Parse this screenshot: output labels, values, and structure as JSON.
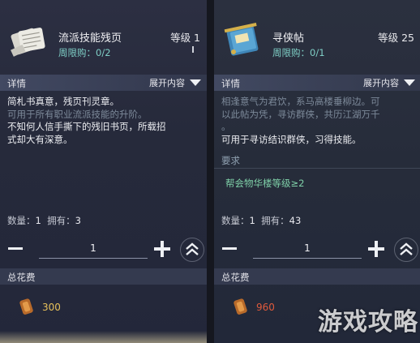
{
  "left_panel": {
    "item_name": "流派技能残页",
    "level": "等级 1",
    "week_limit": "周限购：0/2",
    "details_label": "详情",
    "expand_label": "展开内容",
    "desc_lines": [
      {
        "text": "简札书真意，残页刊灵章。",
        "tone": "bright"
      },
      {
        "text": "可用于所有职业流派技能的升阶。",
        "tone": "dim"
      },
      {
        "text": "不知何人信手撕下的残旧书页，所载招",
        "tone": "bright"
      },
      {
        "text": "式却大有深意。",
        "tone": "bright"
      }
    ],
    "qty_label": "数量：",
    "qty_value": "1",
    "own_label": "拥有：",
    "own_value": "3",
    "stepper_value": "1",
    "total_cost_label": "总花费",
    "cost_value": "300",
    "cost_color": "#e6c05a"
  },
  "right_panel": {
    "item_name": "寻侠帖",
    "level": "等级 25",
    "week_limit": "周限购：0/1",
    "details_label": "详情",
    "expand_label": "展开内容",
    "desc_lines": [
      {
        "text": "相逢意气为君饮，系马高楼垂柳边。可",
        "tone": "dim"
      },
      {
        "text": "以此帖为凭，寻访群侠，共历江湖万千",
        "tone": "dim"
      },
      {
        "text": "。",
        "tone": "dim"
      },
      {
        "text": "可用于寻访结识群侠，习得技能。",
        "tone": "bright"
      }
    ],
    "requirement_label": "要求",
    "requirement_text": "帮会物华楼等级≥2",
    "qty_label": "数量：",
    "qty_value": "1",
    "own_label": "拥有：",
    "own_value": "43",
    "stepper_value": "1",
    "total_cost_label": "总花费",
    "cost_value": "960",
    "cost_color": "#e05a3c"
  },
  "watermark_text": "游戏攻略",
  "icons": [
    "scroll-pages-icon",
    "invitation-book-icon",
    "chevron-down-icon",
    "minus-icon",
    "plus-icon",
    "max-chevron-icon",
    "currency-coin-icon"
  ]
}
